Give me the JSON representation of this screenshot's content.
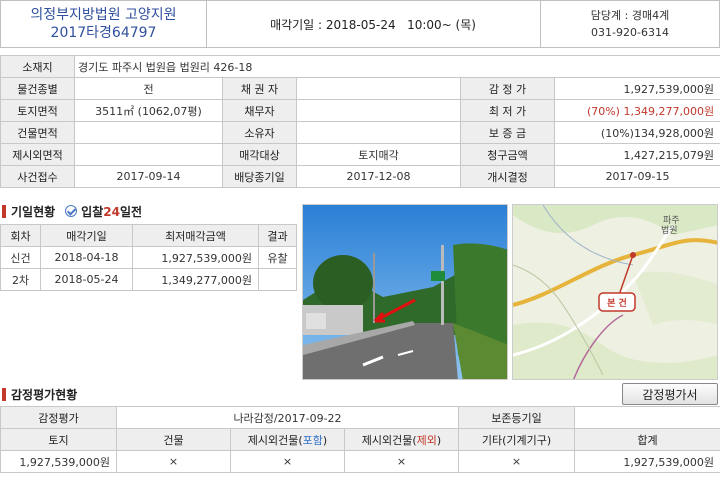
{
  "header": {
    "court": "의정부지방법원 고양지원",
    "case_no": "2017타경64797",
    "sale_date": "매각기일 : 2018-05-24   10:00~ (목)",
    "manager": "담당계 : 경매4계",
    "phone": "031-920-6314"
  },
  "info": {
    "addr_label": "소재지",
    "addr": "경기도 파주시 법원읍 법원리 426-18",
    "rows": [
      {
        "l1": "물건종별",
        "v1": "전",
        "l2": "채 권 자",
        "v2": "",
        "l3": "감 정 가",
        "v3": "1,927,539,000원"
      },
      {
        "l1": "토지면적",
        "v1": "3511㎡ (1062,07평)",
        "l2": "채무자",
        "v2": "",
        "l3": "최 저 가",
        "v3": "(70%) 1,349,277,000원"
      },
      {
        "l1": "건물면적",
        "v1": "",
        "l2": "소유자",
        "v2": "",
        "l3": "보 증 금",
        "v3": "(10%)134,928,000원"
      },
      {
        "l1": "제시외면적",
        "v1": "",
        "l2": "매각대상",
        "v2": "토지매각",
        "l3": "청구금액",
        "v3": "1,427,215,079원"
      },
      {
        "l1": "사건접수",
        "v1": "2017-09-14",
        "l2": "배당종기일",
        "v2": "2017-12-08",
        "l3": "개시결정",
        "v3": "2017-09-15"
      }
    ]
  },
  "history": {
    "title": "기일현황",
    "bid_prefix": "입찰",
    "bid_days": "24",
    "bid_suffix": "일전",
    "headers": [
      "회차",
      "매각기일",
      "최저매각금액",
      "결과"
    ],
    "rows": [
      {
        "round": "신건",
        "date": "2018-04-18",
        "price": "1,927,539,000원",
        "result": "유찰"
      },
      {
        "round": "2차",
        "date": "2018-05-24",
        "price": "1,349,277,000원",
        "result": ""
      }
    ]
  },
  "map_label": "본 건",
  "map_place": "파주\n법원",
  "appraisal": {
    "title": "감정평가현황",
    "button": "감정평가서",
    "label": "감정평가",
    "agency": "나라감정/2017-09-22",
    "reserve_label": "보존등기일",
    "reserve_value": "",
    "headers": {
      "land": "토지",
      "building": "건물",
      "extra_incl_a": "제시외건물(",
      "extra_incl_b": "포함",
      "extra_excl_a": "제시외건물(",
      "extra_excl_b": "제외",
      "close": ")",
      "etc": "기타(기계기구)",
      "total": "합계"
    },
    "values": [
      "1,927,539,000원",
      "×",
      "×",
      "×",
      "×",
      "1,927,539,000원"
    ]
  },
  "colors": {
    "accent_red": "#c0392b",
    "title_blue": "#2f4f9f",
    "label_bg": "#eeeeee"
  }
}
